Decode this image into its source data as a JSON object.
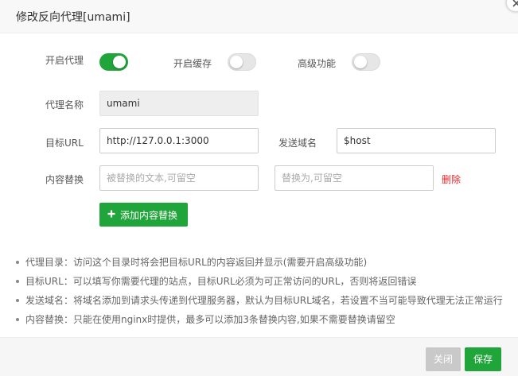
{
  "dialog": {
    "title": "修改反向代理[umami]"
  },
  "form": {
    "enable_proxy_label": "开启代理",
    "enable_proxy": true,
    "enable_cache_label": "开启缓存",
    "enable_cache": false,
    "advanced_label": "高级功能",
    "advanced": false,
    "proxy_name_label": "代理名称",
    "proxy_name_value": "umami",
    "target_url_label": "目标URL",
    "target_url_value": "http://127.0.0.1:3000",
    "send_domain_label": "发送域名",
    "send_domain_value": "$host",
    "content_replace_label": "内容替换",
    "replace_from_placeholder": "被替换的文本,可留空",
    "replace_to_placeholder": "替换为,可留空",
    "delete_label": "删除",
    "add_replace_label": "添加内容替换"
  },
  "tips": [
    "代理目录：访问这个目录时将会把目标URL的内容返回并显示(需要开启高级功能)",
    "目标URL：可以填写你需要代理的站点，目标URL必须为可正常访问的URL，否则将返回错误",
    "发送域名：将域名添加到请求头传递到代理服务器，默认为目标URL域名，若设置不当可能导致代理无法正常运行",
    "内容替换：只能在使用nginx时提供，最多可以添加3条替换内容,如果不需要替换请留空"
  ],
  "footer": {
    "close_label": "关闭",
    "save_label": "保存"
  },
  "colors": {
    "accent": "#20a53a",
    "danger": "#e52a2a",
    "disabled": "#c9c9c9"
  }
}
